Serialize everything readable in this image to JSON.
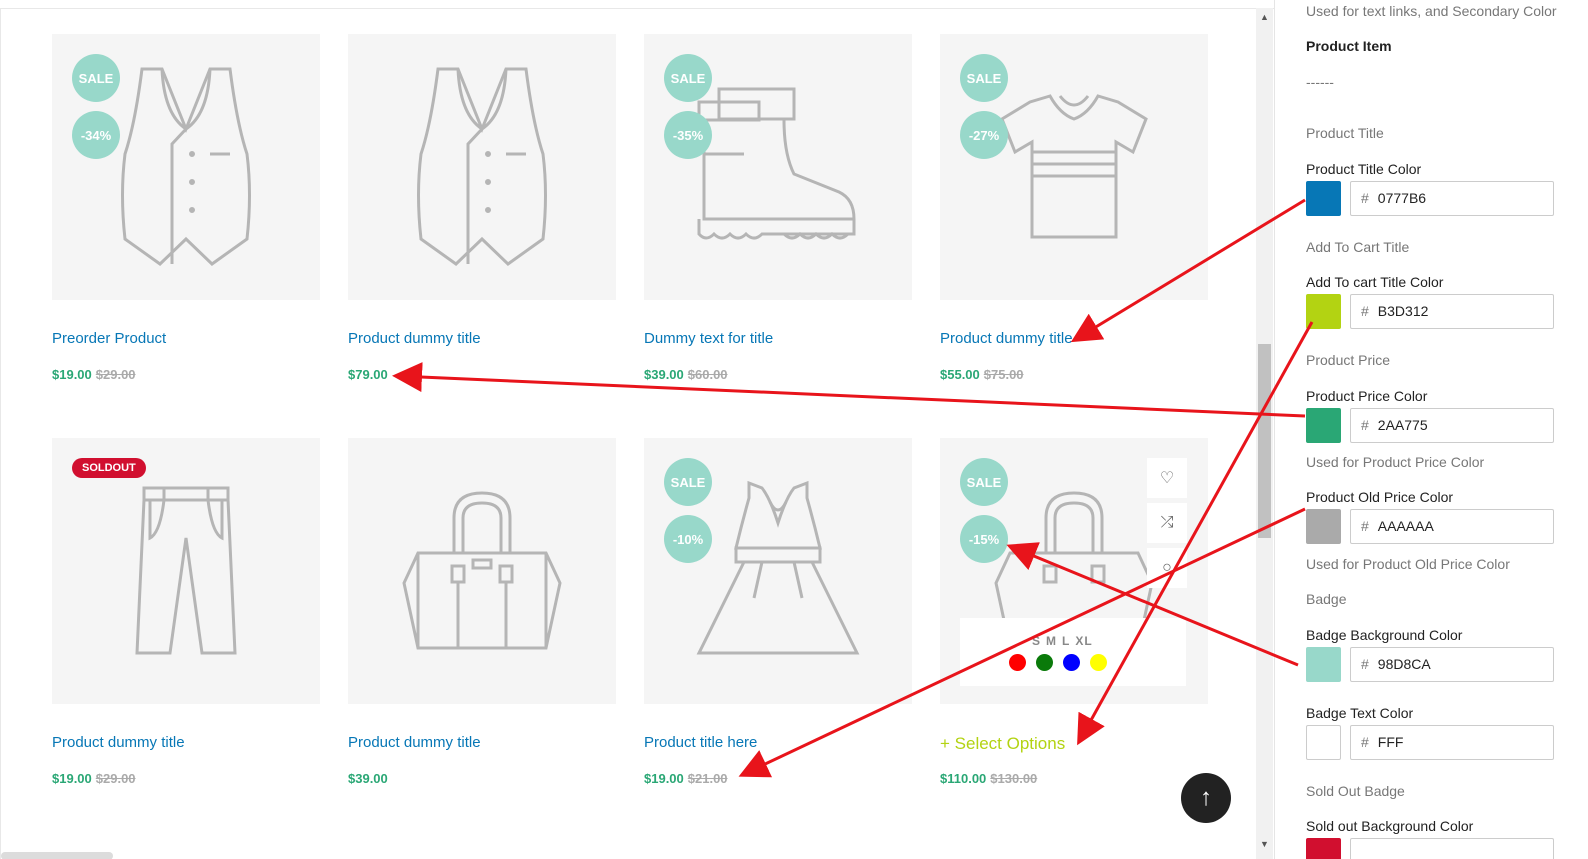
{
  "products": [
    {
      "title": "Preorder Product",
      "price": "$19.00",
      "old_price": "$29.00",
      "badge_sale": "SALE",
      "badge_pct": "-34%",
      "icon": "vest-icon"
    },
    {
      "title": "Product dummy title",
      "price": "$79.00",
      "old_price": "",
      "badge_sale": "",
      "badge_pct": "",
      "icon": "vest-icon"
    },
    {
      "title": "Dummy text for title",
      "price": "$39.00",
      "old_price": "$60.00",
      "badge_sale": "SALE",
      "badge_pct": "-35%",
      "icon": "boot-icon"
    },
    {
      "title": "Product dummy title",
      "price": "$55.00",
      "old_price": "$75.00",
      "badge_sale": "SALE",
      "badge_pct": "-27%",
      "icon": "tshirt-icon"
    },
    {
      "title": "Product dummy title",
      "price": "$19.00",
      "old_price": "$29.00",
      "badge_soldout": "SOLDOUT",
      "icon": "pants-icon"
    },
    {
      "title": "Product dummy title",
      "price": "$39.00",
      "old_price": "",
      "icon": "handbag-icon"
    },
    {
      "title": "Product title here",
      "price": "$19.00",
      "old_price": "$21.00",
      "badge_sale": "SALE",
      "badge_pct": "-10%",
      "icon": "dress-icon"
    },
    {
      "title": "+ Select Options",
      "price": "$110.00",
      "old_price": "$130.00",
      "badge_sale": "SALE",
      "badge_pct": "-15%",
      "icon": "handbag-icon"
    }
  ],
  "variants": {
    "sizes": [
      "S",
      "M",
      "L",
      "XL"
    ],
    "swatches": [
      "#ff0000",
      "#0a7a0a",
      "#0000ff",
      "#ffff00",
      "#ffffff"
    ]
  },
  "panel": {
    "top_note": "Used for text links, and Secondary Color",
    "section_product_item": "Product Item",
    "separator": "------",
    "product_title": "Product Title",
    "product_title_color_label": "Product Title Color",
    "product_title_color": "0777B6",
    "add_to_cart_title": "Add To Cart Title",
    "add_to_cart_color_label": "Add To cart Title Color",
    "add_to_cart_color": "B3D312",
    "product_price": "Product Price",
    "product_price_color_label": "Product Price Color",
    "product_price_color": "2AA775",
    "product_price_note": "Used for Product Price Color",
    "old_price_color_label": "Product Old Price Color",
    "old_price_color": "AAAAAA",
    "old_price_note": "Used for Product Old Price Color",
    "badge": "Badge",
    "badge_bg_label": "Badge Background Color",
    "badge_bg_color": "98D8CA",
    "badge_text_label": "Badge Text Color",
    "badge_text_color": "FFF",
    "soldout_badge": "Sold Out Badge",
    "soldout_bg_label": "Sold out Background Color",
    "hash": "#"
  },
  "colors": {
    "title": "#0777B6",
    "add_to_cart": "#B3D312",
    "price": "#2AA775",
    "old_price": "#AAAAAA",
    "badge_bg": "#98D8CA",
    "badge_text": "#FFFFFF",
    "soldout_bg": "#D10F2F",
    "arrow": "#E8141B"
  }
}
